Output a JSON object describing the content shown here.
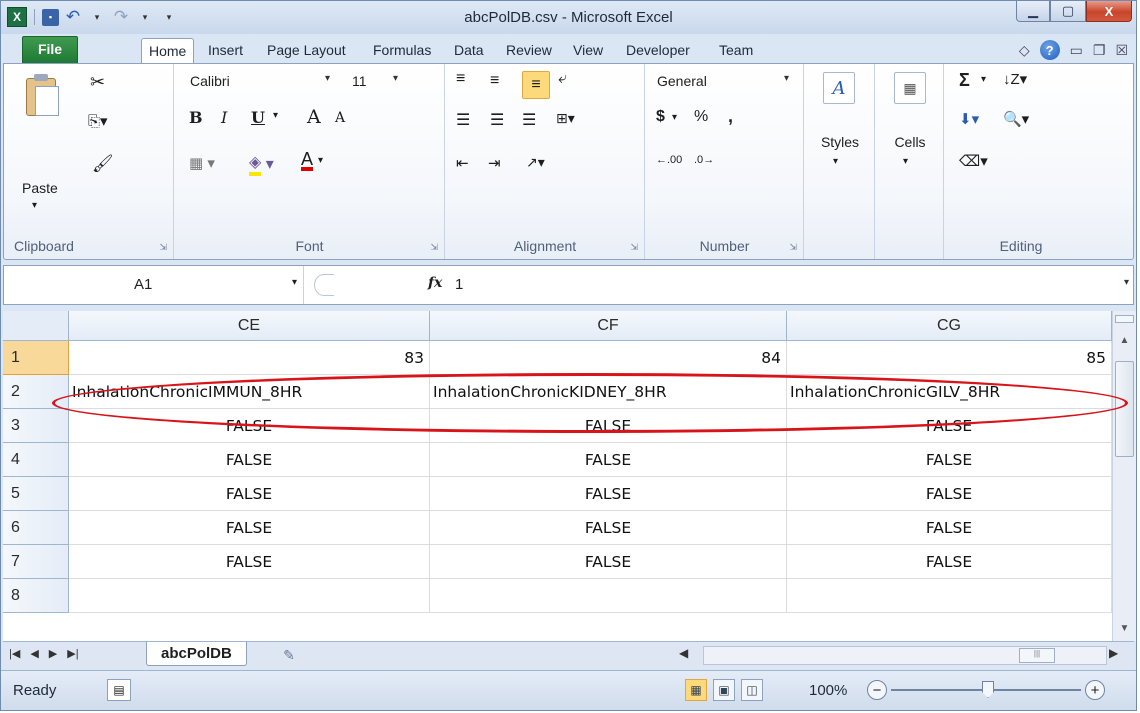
{
  "window": {
    "title": "abcPolDB.csv  -  Microsoft Excel"
  },
  "qat": {
    "sep_glyph": "|",
    "customize_glyph": "▾"
  },
  "window_buttons": {
    "minimize": "▁",
    "maximize": "▢",
    "close": "X"
  },
  "tabs": [
    {
      "label": "File"
    },
    {
      "label": "Home"
    },
    {
      "label": "Insert"
    },
    {
      "label": "Page Layout"
    },
    {
      "label": "Formulas"
    },
    {
      "label": "Data"
    },
    {
      "label": "Review"
    },
    {
      "label": "View"
    },
    {
      "label": "Developer"
    },
    {
      "label": "Team"
    }
  ],
  "ribbon": {
    "clipboard": {
      "label": "Clipboard",
      "paste": "Paste"
    },
    "font": {
      "label": "Font",
      "name": "Calibri",
      "size": "11",
      "bold": "B",
      "italic": "I",
      "underline": "U",
      "grow": "A",
      "shrink": "A",
      "font_color": "A"
    },
    "alignment": {
      "label": "Alignment"
    },
    "number": {
      "label": "Number",
      "format": "General",
      "currency": "$",
      "percent": "%",
      "comma": ",",
      "inc_dec": ".00",
      "dec_dec": ".0"
    },
    "styles": {
      "label": "Styles"
    },
    "cells": {
      "label": "Cells"
    },
    "editing": {
      "label": "Editing",
      "sum": "Σ"
    }
  },
  "formula_bar": {
    "name_box": "A1",
    "fx": "fx",
    "value": "1"
  },
  "grid": {
    "columns": [
      "CE",
      "CF",
      "CG"
    ],
    "rows": [
      {
        "num": "1",
        "cells": [
          "83",
          "84",
          "85"
        ],
        "kind": "num"
      },
      {
        "num": "2",
        "cells": [
          "InhalationChronicIMMUN_8HR",
          "InhalationChronicKIDNEY_8HR",
          "InhalationChronicGILV_8HR"
        ],
        "kind": "txt"
      },
      {
        "num": "3",
        "cells": [
          "FALSE",
          "FALSE",
          "FALSE"
        ],
        "kind": "bool"
      },
      {
        "num": "4",
        "cells": [
          "FALSE",
          "FALSE",
          "FALSE"
        ],
        "kind": "bool"
      },
      {
        "num": "5",
        "cells": [
          "FALSE",
          "FALSE",
          "FALSE"
        ],
        "kind": "bool"
      },
      {
        "num": "6",
        "cells": [
          "FALSE",
          "FALSE",
          "FALSE"
        ],
        "kind": "bool"
      },
      {
        "num": "7",
        "cells": [
          "FALSE",
          "FALSE",
          "FALSE"
        ],
        "kind": "bool"
      },
      {
        "num": "8",
        "cells": [
          "",
          "",
          ""
        ],
        "kind": "bool"
      }
    ]
  },
  "sheet_tabs": {
    "active": "abcPolDB"
  },
  "status": {
    "text": "Ready",
    "zoom": "100%",
    "zoom_minus": "−",
    "zoom_plus": "+"
  },
  "colors": {
    "accent": "#1e7145",
    "active_header": "#f9d99a",
    "annotation": "#d8141a"
  }
}
